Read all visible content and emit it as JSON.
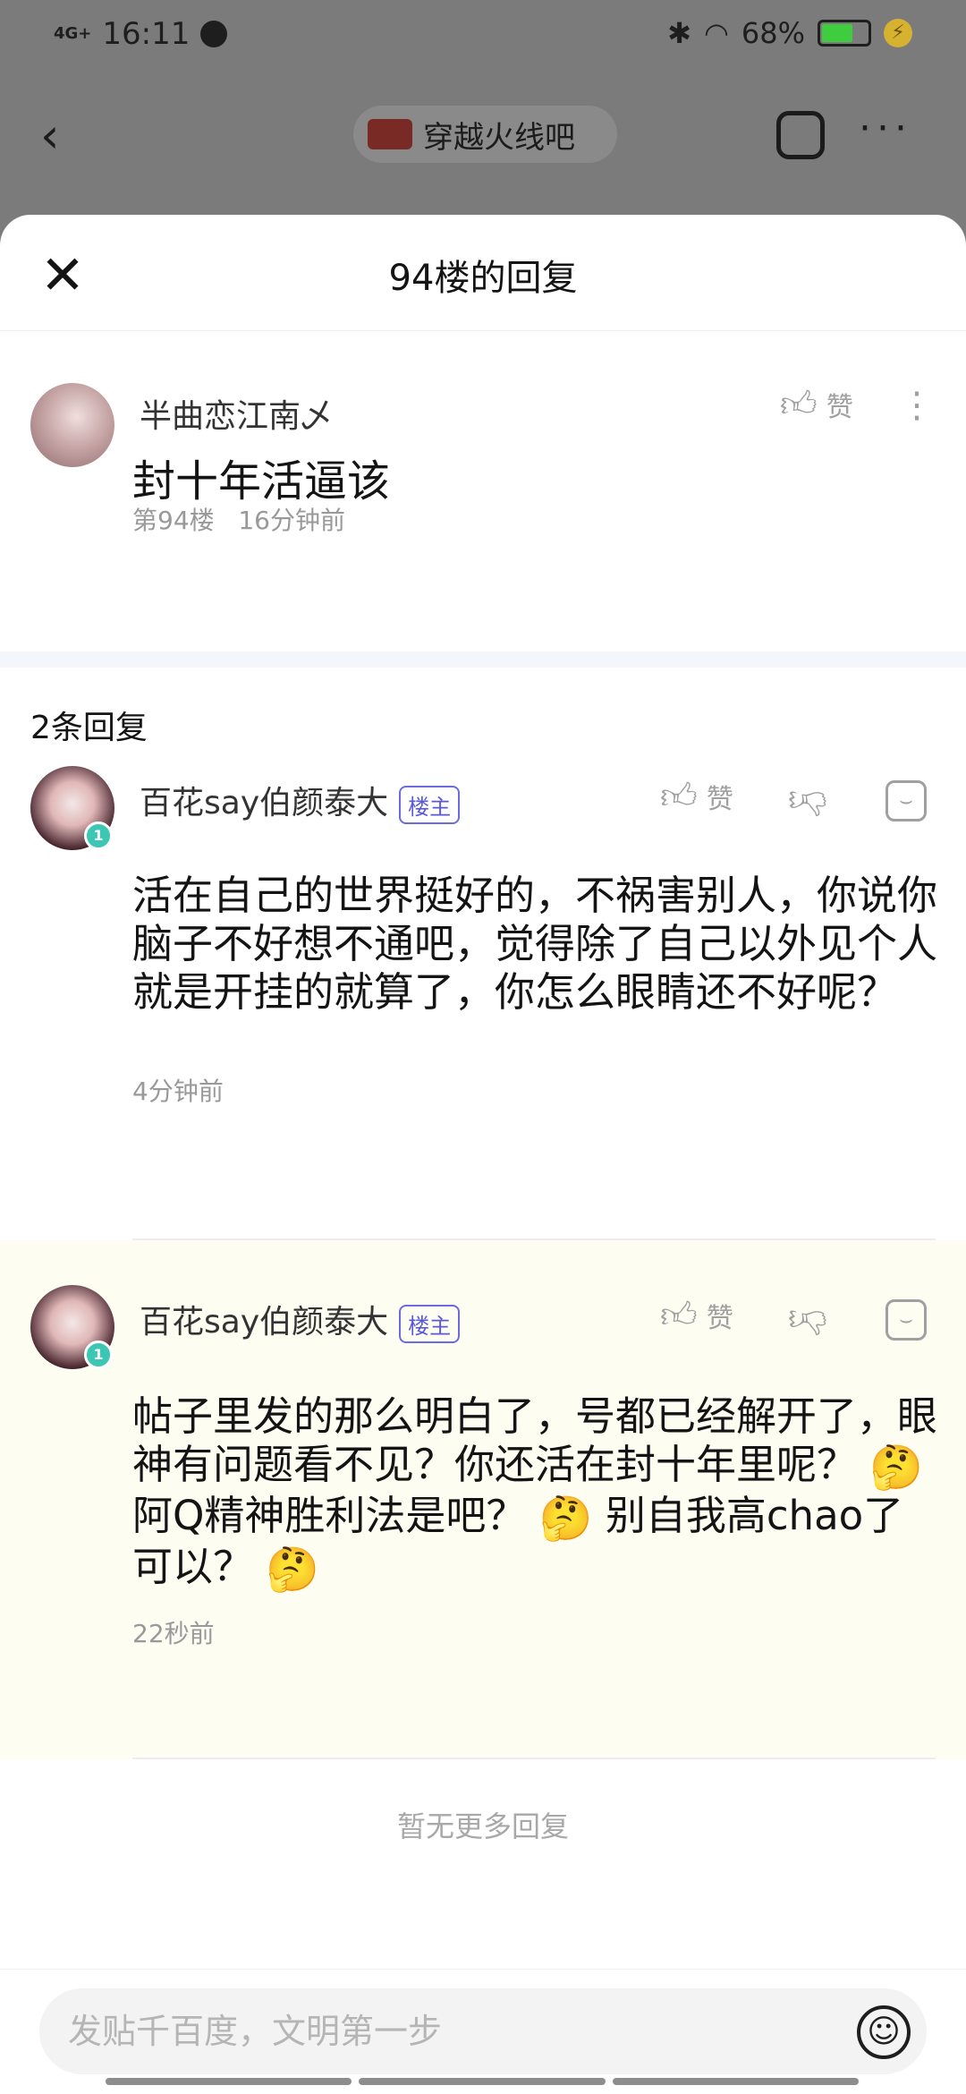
{
  "status_bar": {
    "network": "4G+",
    "time": "16:11",
    "battery_percent": "68%",
    "battery_level": 0.68,
    "battery_color": "#3fcc3f",
    "icons": [
      "bluetooth-icon",
      "wifi-icon",
      "battery-icon",
      "charging-icon"
    ]
  },
  "background_nav": {
    "forum_name": "穿越火线吧",
    "icons": [
      "back-icon",
      "edit-icon",
      "more-icon"
    ]
  },
  "sheet": {
    "title": "94楼的回复",
    "close_icon": "close-icon"
  },
  "main_post": {
    "username": "半曲恋江南乄",
    "like_label": "赞",
    "content": "封十年活逼该",
    "floor": "第94楼",
    "time": "16分钟前"
  },
  "replies_header": "2条回复",
  "replies": [
    {
      "username": "百花say伯颜泰大",
      "badge": "楼主",
      "level": "1",
      "like_label": "赞",
      "content": "活在自己的世界挺好的，不祸害别人，你说你脑子不好想不通吧，觉得除了自己以外见个人就是开挂的就算了，你怎么眼睛还不好呢？",
      "time": "4分钟前"
    },
    {
      "username": "百花say伯颜泰大",
      "badge": "楼主",
      "level": "1",
      "like_label": "赞",
      "content_part1": "帖子里发的那么明白了，号都已经解开了，眼神有问题看不见？你还活在封十年里呢？",
      "content_part2": "阿Q精神胜利法是吧？",
      "content_part3": "别自我高chao了可以？",
      "emoji": "🤔",
      "time": "22秒前"
    }
  ],
  "no_more": "暂无更多回复",
  "input": {
    "placeholder": "发贴千百度，文明第一步"
  },
  "colors": {
    "host_tag": "#5a5ad8",
    "level_badge": "#3cc7b4",
    "highlight_row": "#fefdf2"
  }
}
